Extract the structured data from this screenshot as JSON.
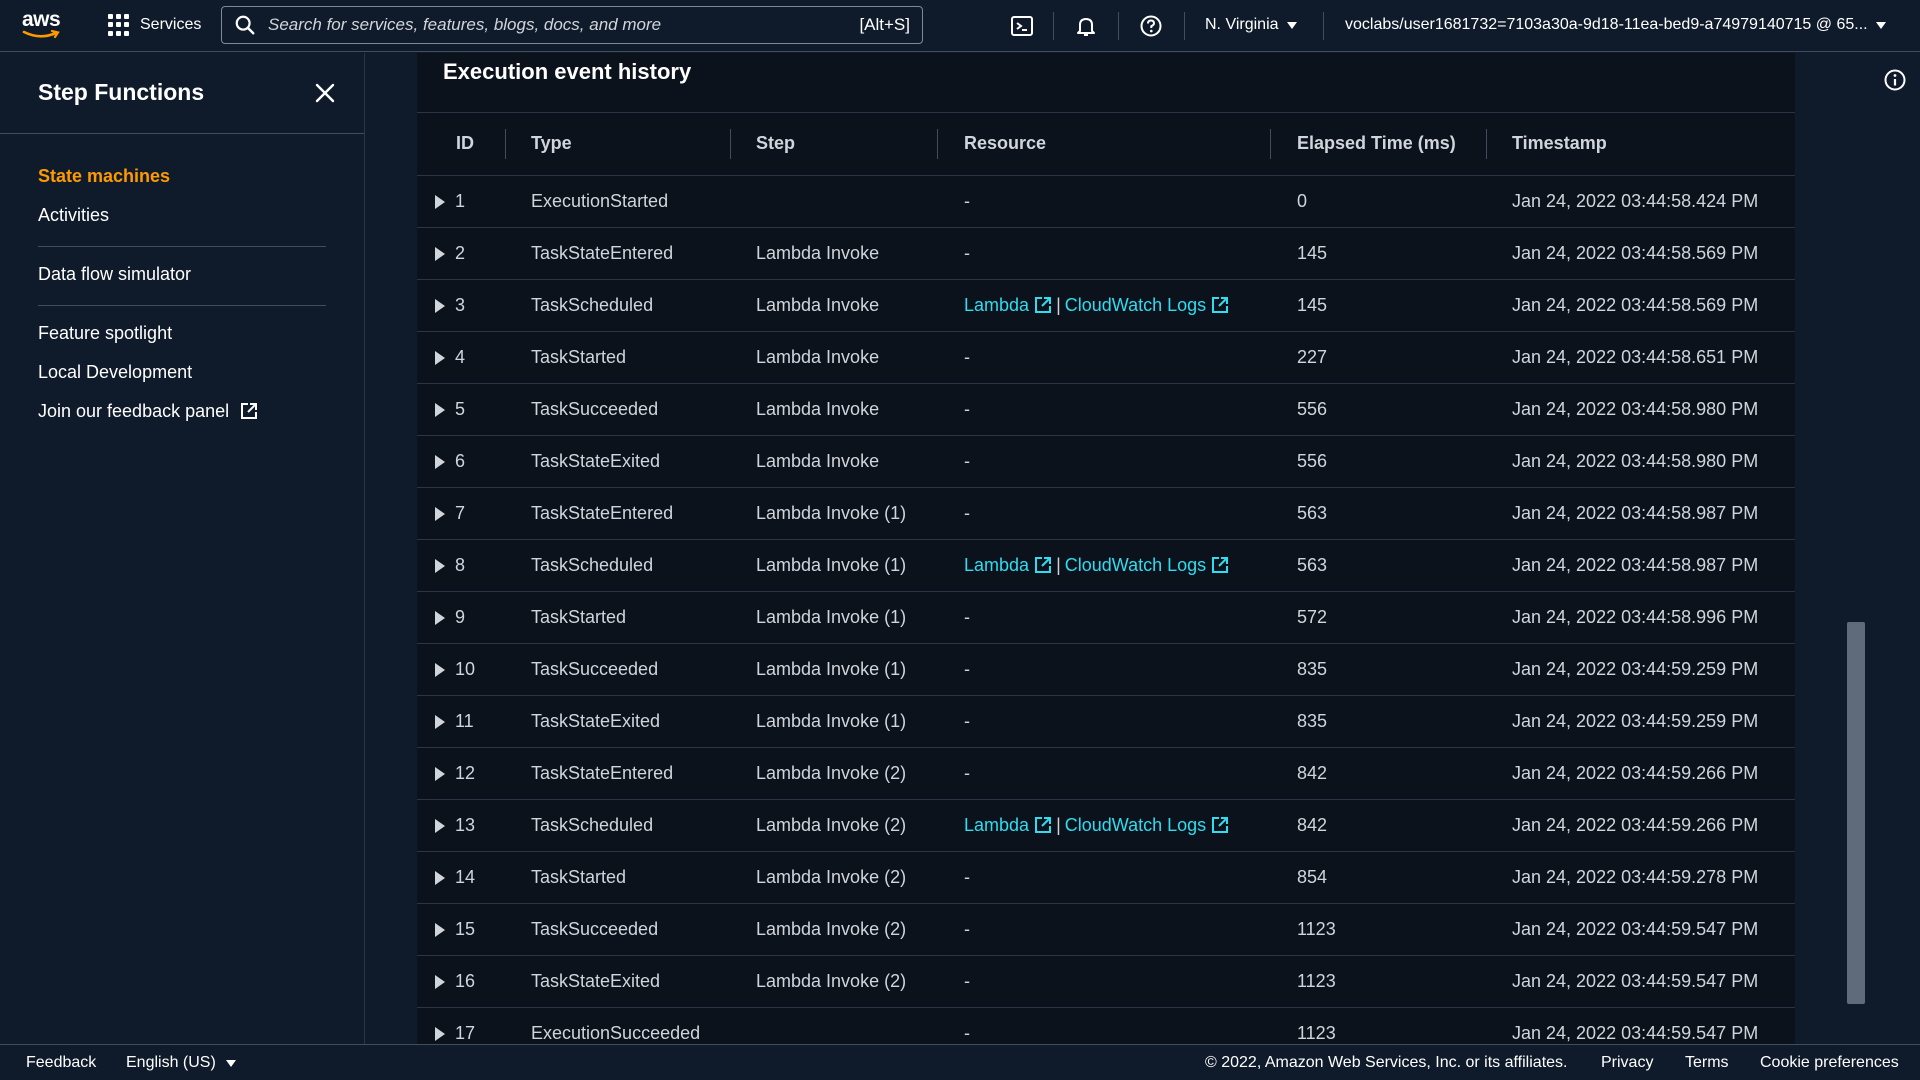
{
  "topnav": {
    "logo_text": "aws",
    "services_label": "Services",
    "search_placeholder": "Search for services, features, blogs, docs, and more",
    "search_shortcut": "[Alt+S]",
    "region": "N. Virginia",
    "account": "voclabs/user1681732=7103a30a-9d18-11ea-bed9-a74979140715 @ 65..."
  },
  "sidebar": {
    "title": "Step Functions",
    "items": {
      "state_machines": "State machines",
      "activities": "Activities",
      "data_flow_simulator": "Data flow simulator",
      "feature_spotlight": "Feature spotlight",
      "local_development": "Local Development",
      "feedback_panel": "Join our feedback panel"
    }
  },
  "panel": {
    "title": "Execution event history",
    "columns": {
      "id": "ID",
      "type": "Type",
      "step": "Step",
      "resource": "Resource",
      "elapsed": "Elapsed Time (ms)",
      "timestamp": "Timestamp"
    },
    "resource_links": {
      "lambda": "Lambda",
      "separator": "|",
      "cloudwatch": "CloudWatch Logs"
    },
    "rows": [
      {
        "id": "1",
        "type": "ExecutionStarted",
        "step": "",
        "resource": "-",
        "elapsed": "0",
        "timestamp": "Jan 24, 2022 03:44:58.424 PM"
      },
      {
        "id": "2",
        "type": "TaskStateEntered",
        "step": "Lambda Invoke",
        "resource": "-",
        "elapsed": "145",
        "timestamp": "Jan 24, 2022 03:44:58.569 PM"
      },
      {
        "id": "3",
        "type": "TaskScheduled",
        "step": "Lambda Invoke",
        "resource": "links",
        "elapsed": "145",
        "timestamp": "Jan 24, 2022 03:44:58.569 PM"
      },
      {
        "id": "4",
        "type": "TaskStarted",
        "step": "Lambda Invoke",
        "resource": "-",
        "elapsed": "227",
        "timestamp": "Jan 24, 2022 03:44:58.651 PM"
      },
      {
        "id": "5",
        "type": "TaskSucceeded",
        "step": "Lambda Invoke",
        "resource": "-",
        "elapsed": "556",
        "timestamp": "Jan 24, 2022 03:44:58.980 PM"
      },
      {
        "id": "6",
        "type": "TaskStateExited",
        "step": "Lambda Invoke",
        "resource": "-",
        "elapsed": "556",
        "timestamp": "Jan 24, 2022 03:44:58.980 PM"
      },
      {
        "id": "7",
        "type": "TaskStateEntered",
        "step": "Lambda Invoke (1)",
        "resource": "-",
        "elapsed": "563",
        "timestamp": "Jan 24, 2022 03:44:58.987 PM"
      },
      {
        "id": "8",
        "type": "TaskScheduled",
        "step": "Lambda Invoke (1)",
        "resource": "links",
        "elapsed": "563",
        "timestamp": "Jan 24, 2022 03:44:58.987 PM"
      },
      {
        "id": "9",
        "type": "TaskStarted",
        "step": "Lambda Invoke (1)",
        "resource": "-",
        "elapsed": "572",
        "timestamp": "Jan 24, 2022 03:44:58.996 PM"
      },
      {
        "id": "10",
        "type": "TaskSucceeded",
        "step": "Lambda Invoke (1)",
        "resource": "-",
        "elapsed": "835",
        "timestamp": "Jan 24, 2022 03:44:59.259 PM"
      },
      {
        "id": "11",
        "type": "TaskStateExited",
        "step": "Lambda Invoke (1)",
        "resource": "-",
        "elapsed": "835",
        "timestamp": "Jan 24, 2022 03:44:59.259 PM"
      },
      {
        "id": "12",
        "type": "TaskStateEntered",
        "step": "Lambda Invoke (2)",
        "resource": "-",
        "elapsed": "842",
        "timestamp": "Jan 24, 2022 03:44:59.266 PM"
      },
      {
        "id": "13",
        "type": "TaskScheduled",
        "step": "Lambda Invoke (2)",
        "resource": "links",
        "elapsed": "842",
        "timestamp": "Jan 24, 2022 03:44:59.266 PM"
      },
      {
        "id": "14",
        "type": "TaskStarted",
        "step": "Lambda Invoke (2)",
        "resource": "-",
        "elapsed": "854",
        "timestamp": "Jan 24, 2022 03:44:59.278 PM"
      },
      {
        "id": "15",
        "type": "TaskSucceeded",
        "step": "Lambda Invoke (2)",
        "resource": "-",
        "elapsed": "1123",
        "timestamp": "Jan 24, 2022 03:44:59.547 PM"
      },
      {
        "id": "16",
        "type": "TaskStateExited",
        "step": "Lambda Invoke (2)",
        "resource": "-",
        "elapsed": "1123",
        "timestamp": "Jan 24, 2022 03:44:59.547 PM"
      },
      {
        "id": "17",
        "type": "ExecutionSucceeded",
        "step": "",
        "resource": "-",
        "elapsed": "1123",
        "timestamp": "Jan 24, 2022 03:44:59.547 PM"
      }
    ]
  },
  "footer": {
    "feedback": "Feedback",
    "language": "English (US)",
    "copyright": "© 2022, Amazon Web Services, Inc. or its affiliates.",
    "privacy": "Privacy",
    "terms": "Terms",
    "cookies": "Cookie preferences"
  },
  "colors": {
    "accent": "#ff9900",
    "link": "#2fdcf0",
    "background": "#0f1b2a"
  },
  "icons": [
    "aws-logo",
    "grid-icon",
    "search-icon",
    "cloudshell-icon",
    "bell-icon",
    "help-icon",
    "close-icon",
    "external-link-icon",
    "expand-triangle-icon",
    "info-icon"
  ]
}
